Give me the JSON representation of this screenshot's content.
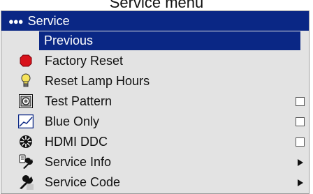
{
  "caption": "Service menu",
  "menu": {
    "title": "Service",
    "title_prefix": "●●●",
    "items": [
      {
        "label": "Previous",
        "icon": "none",
        "control": "none",
        "selected": true
      },
      {
        "label": "Factory Reset",
        "icon": "stop-sign-icon",
        "control": "none"
      },
      {
        "label": "Reset Lamp Hours",
        "icon": "lightbulb-icon",
        "control": "none"
      },
      {
        "label": "Test Pattern",
        "icon": "test-pattern-icon",
        "control": "checkbox",
        "checked": false
      },
      {
        "label": "Blue Only",
        "icon": "blue-only-icon",
        "control": "checkbox",
        "checked": false
      },
      {
        "label": "HDMI DDC",
        "icon": "hdmi-ddc-icon",
        "control": "checkbox",
        "checked": false
      },
      {
        "label": "Service Info",
        "icon": "wrench-info-icon",
        "control": "submenu-arrow"
      },
      {
        "label": "Service Code",
        "icon": "wrench-code-icon",
        "control": "submenu-arrow"
      }
    ]
  },
  "colors": {
    "header_bg": "#0a2785",
    "menu_bg": "#e3e3e3",
    "stop_red": "#d8121b",
    "bulb_yellow": "#f6e35a"
  }
}
